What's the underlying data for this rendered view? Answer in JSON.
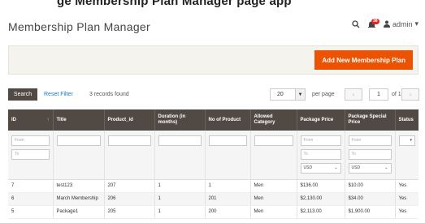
{
  "banner": {
    "text": "ge Membership Plan Manager page app"
  },
  "header": {
    "title": "Membership Plan Manager",
    "notification_count": "38",
    "user": "admin"
  },
  "actions": {
    "add_label": "Add New Membership Plan"
  },
  "toolbar": {
    "search_label": "Search",
    "reset_label": "Reset Filter",
    "records_label": "3 records found",
    "per_page_value": "20",
    "per_page_label": "per page",
    "page_value": "1",
    "page_of": "of 1"
  },
  "columns": [
    "ID",
    "Title",
    "Product_id",
    "Duration (in months)",
    "No of Product",
    "Allowed Category",
    "Package Price",
    "Package Special Price",
    "Status"
  ],
  "filters": {
    "from_placeholder": "From",
    "to_placeholder": "To",
    "currency": "USD"
  },
  "rows": [
    {
      "id": "7",
      "title": "test123",
      "product_id": "207",
      "duration": "1",
      "num_products": "1",
      "category": "Men",
      "price": "$136.00",
      "special_price": "$10.00",
      "status": "Yes"
    },
    {
      "id": "6",
      "title": "March Membership",
      "product_id": "206",
      "duration": "1",
      "num_products": "201",
      "category": "Men",
      "price": "$2,130.00",
      "special_price": "$34.00",
      "status": "Yes"
    },
    {
      "id": "5",
      "title": "Package1",
      "product_id": "205",
      "duration": "1",
      "num_products": "200",
      "category": "Men",
      "price": "$2,113.00",
      "special_price": "$1,900.00",
      "status": "Yes"
    }
  ],
  "colors": {
    "accent": "#eb5202",
    "header_bg": "#514943",
    "link": "#1979c3"
  }
}
